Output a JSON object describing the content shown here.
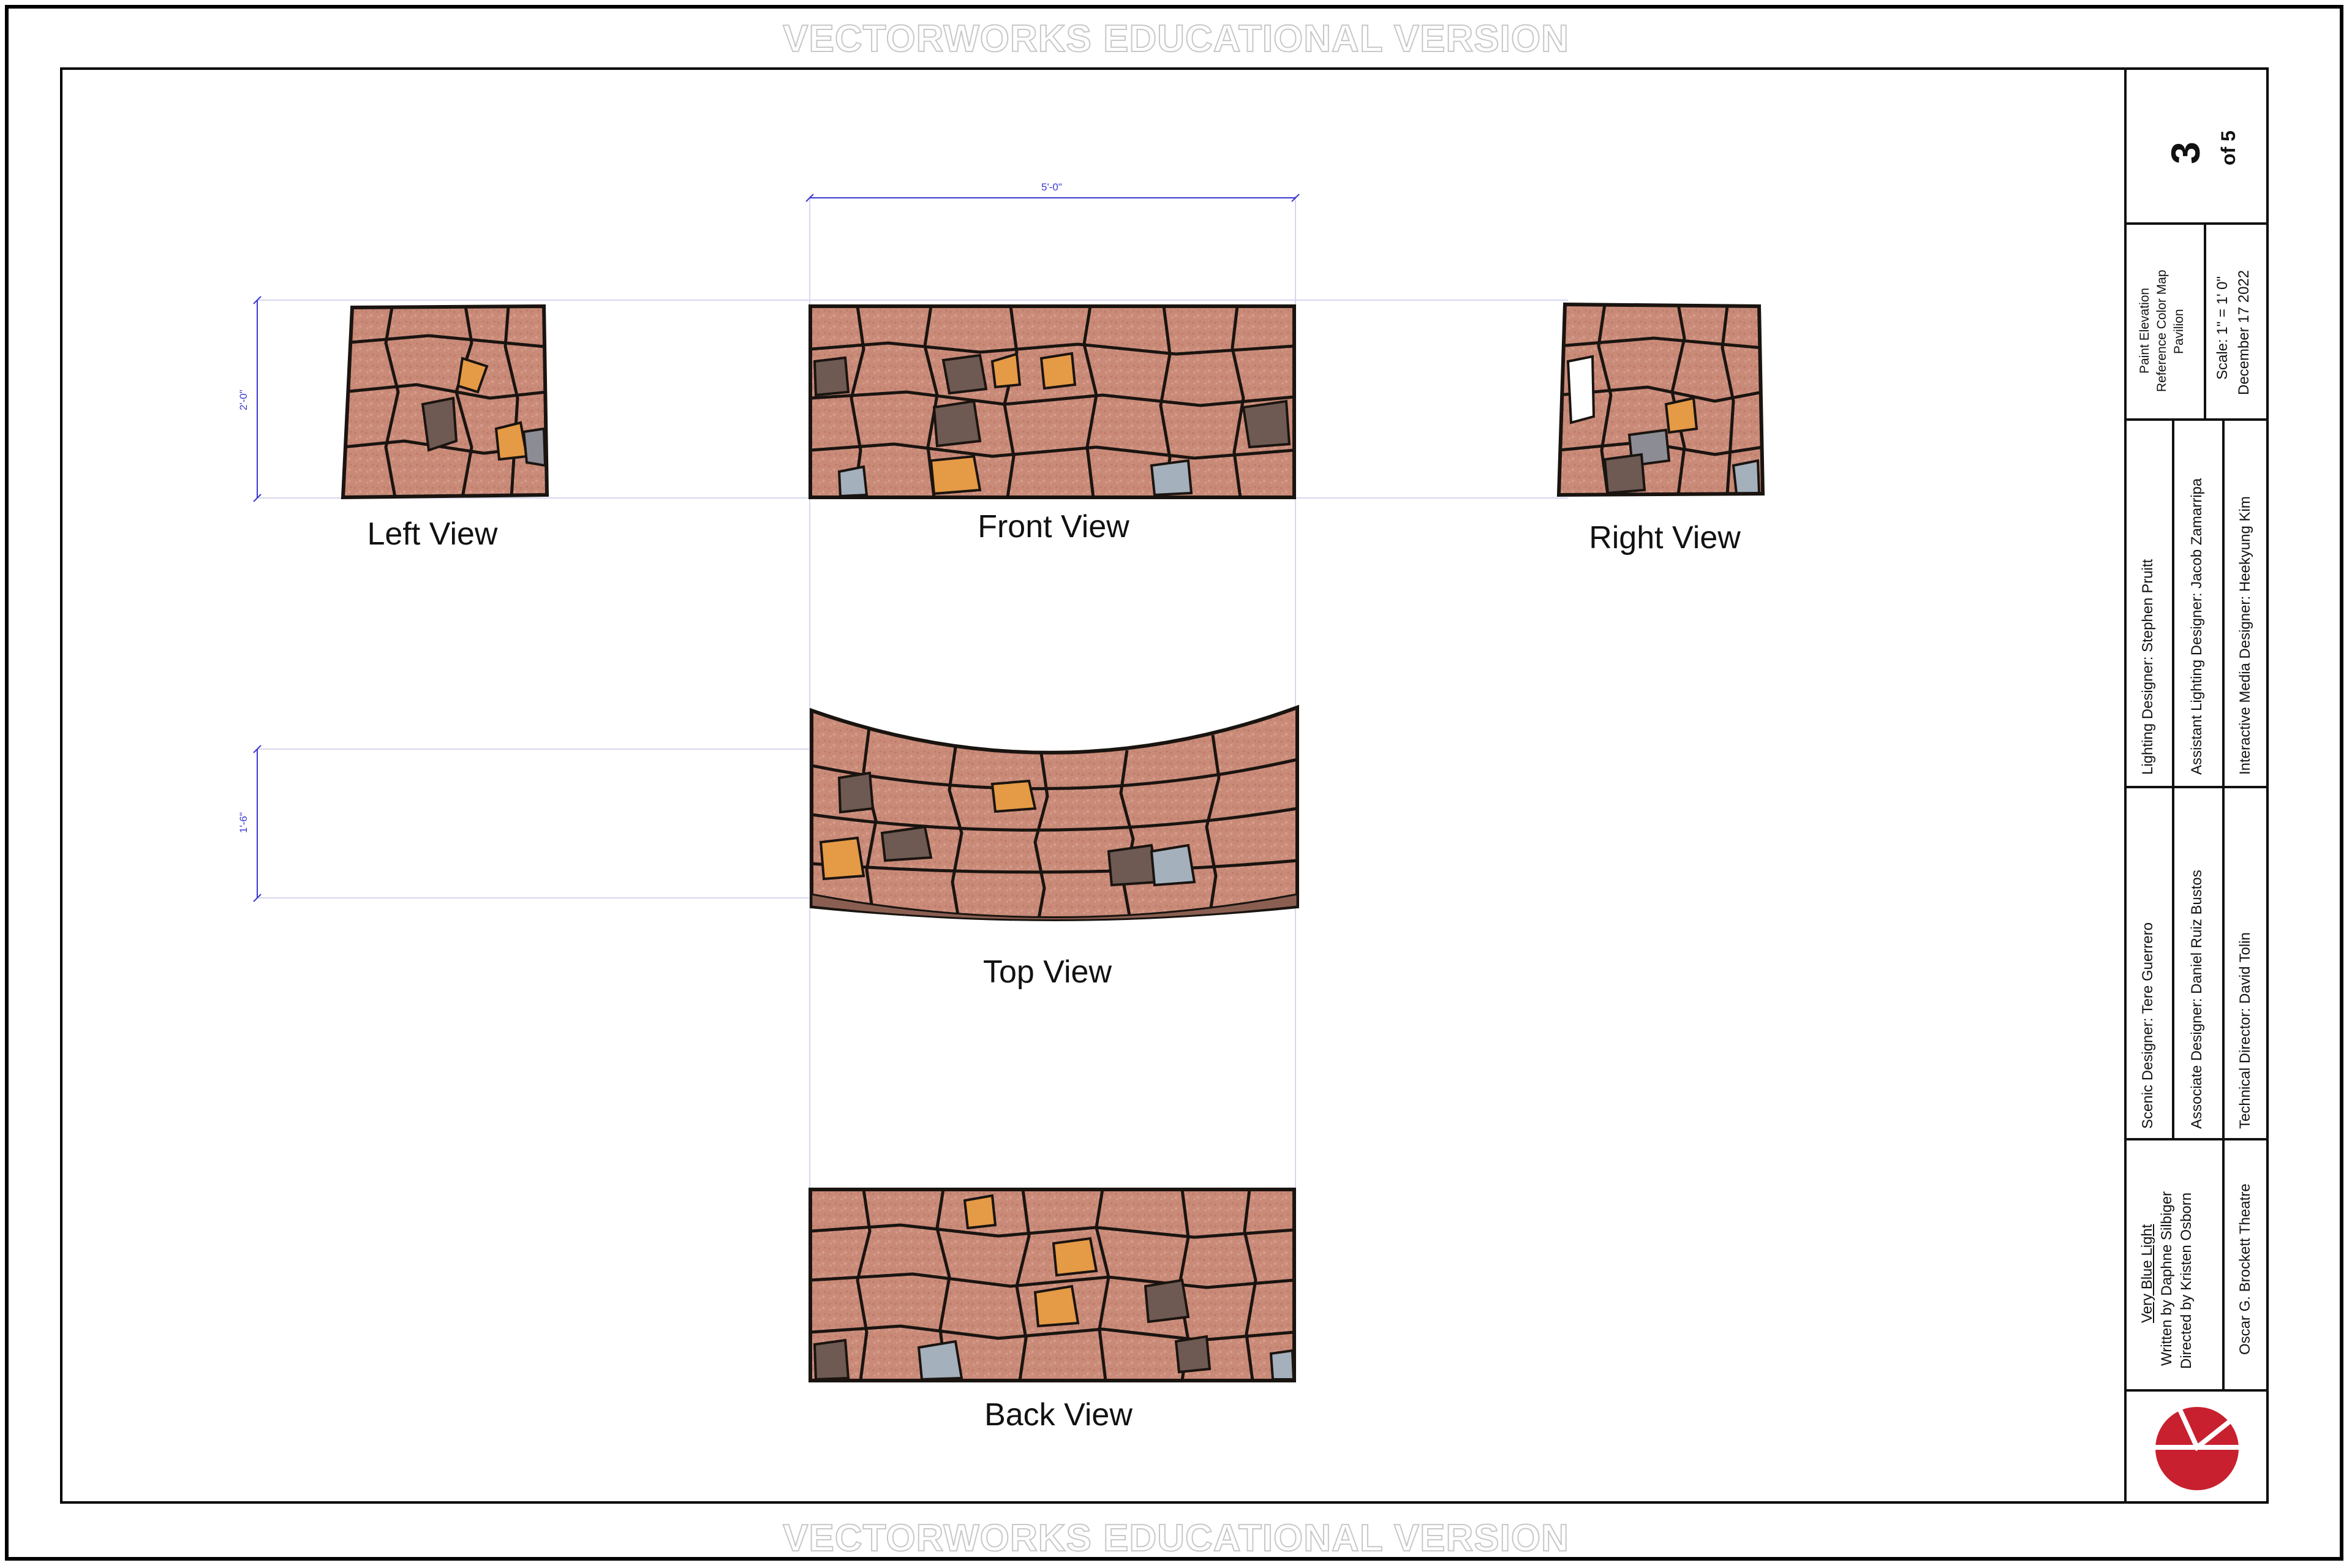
{
  "watermark": "VECTORWORKS EDUCATIONAL VERSION",
  "views": {
    "left": "Left View",
    "front": "Front View",
    "right": "Right View",
    "top": "Top View",
    "back": "Back View"
  },
  "dimensions": {
    "width": "5'-0\"",
    "height_front": "2'-0\"",
    "height_top": "1'-6\""
  },
  "title_block": {
    "sheet_number": "3",
    "sheet_of": "of 5",
    "sheet_title_line1": "Paint Elevation",
    "sheet_title_line2": "Reference Color Map",
    "sheet_title_line3": "Pavilion",
    "scale": "Scale: 1\" = 1' 0\"",
    "date": "December 17  2022",
    "lighting_designer": "Lighting Designer: Stephen Pruitt",
    "assistant_lighting_designer": "Assistant Lighting Designer: Jacob Zamarripa",
    "interactive_media_designer": "Interactive Media Designer: Heekyung Kim",
    "scenic_designer": "Scenic Designer: Tere Guerrero",
    "associate_designer": "Associate Designer: Daniel Ruiz Bustos",
    "technical_director": "Technical Director: David Tolin",
    "production_title": "Very Blue Light",
    "written_by": "Written by Daphne Silbiger",
    "directed_by": "Directed by Kristen Osborn",
    "theatre": "Oscar G. Brockett Theatre"
  },
  "colors": {
    "stone_base": "#c98a78",
    "stone_light": "#d9a08e",
    "stone_orange": "#e59a45",
    "stone_grey": "#8c8c94",
    "stone_dark": "#6e5a52",
    "stone_blue": "#a4b0bc",
    "dimension": "#3a3ad0",
    "logo_red": "#c8202f"
  }
}
